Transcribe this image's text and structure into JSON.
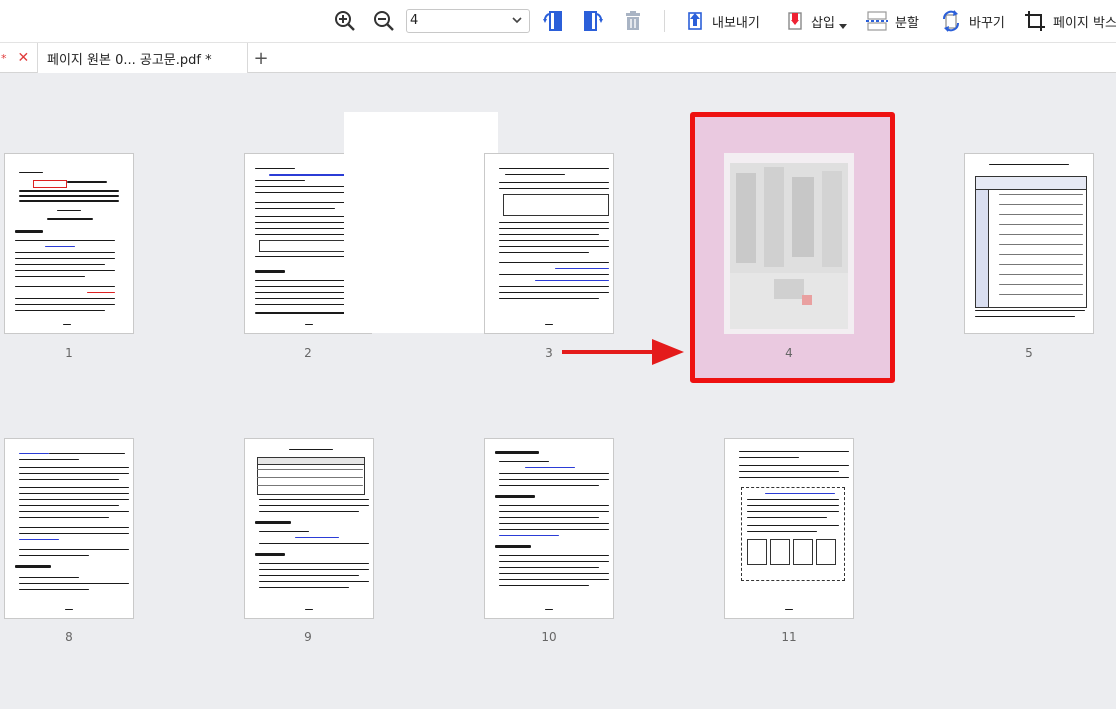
{
  "toolbar": {
    "zoom_value": "4",
    "export_label": "내보내기",
    "insert_label": "삽입",
    "split_label": "분할",
    "replace_label": "바꾸기",
    "pagebox_label": "페이지 박스"
  },
  "tabs": [
    {
      "label": "페이지 원본 0... 공고문.pdf *"
    }
  ],
  "add_tab_symbol": "+",
  "close_symbol": "✕",
  "pages": [
    {
      "label": "1"
    },
    {
      "label": "2"
    },
    {
      "label": "3"
    },
    {
      "label": "4"
    },
    {
      "label": "5"
    },
    {
      "label": "8"
    },
    {
      "label": "9"
    },
    {
      "label": "10"
    },
    {
      "label": "11"
    }
  ],
  "colors": {
    "selection_border": "#ee1111",
    "selection_fill": "#eac9e0",
    "arrow": "#e41b1b",
    "accent_blue": "#2b5fd9"
  }
}
